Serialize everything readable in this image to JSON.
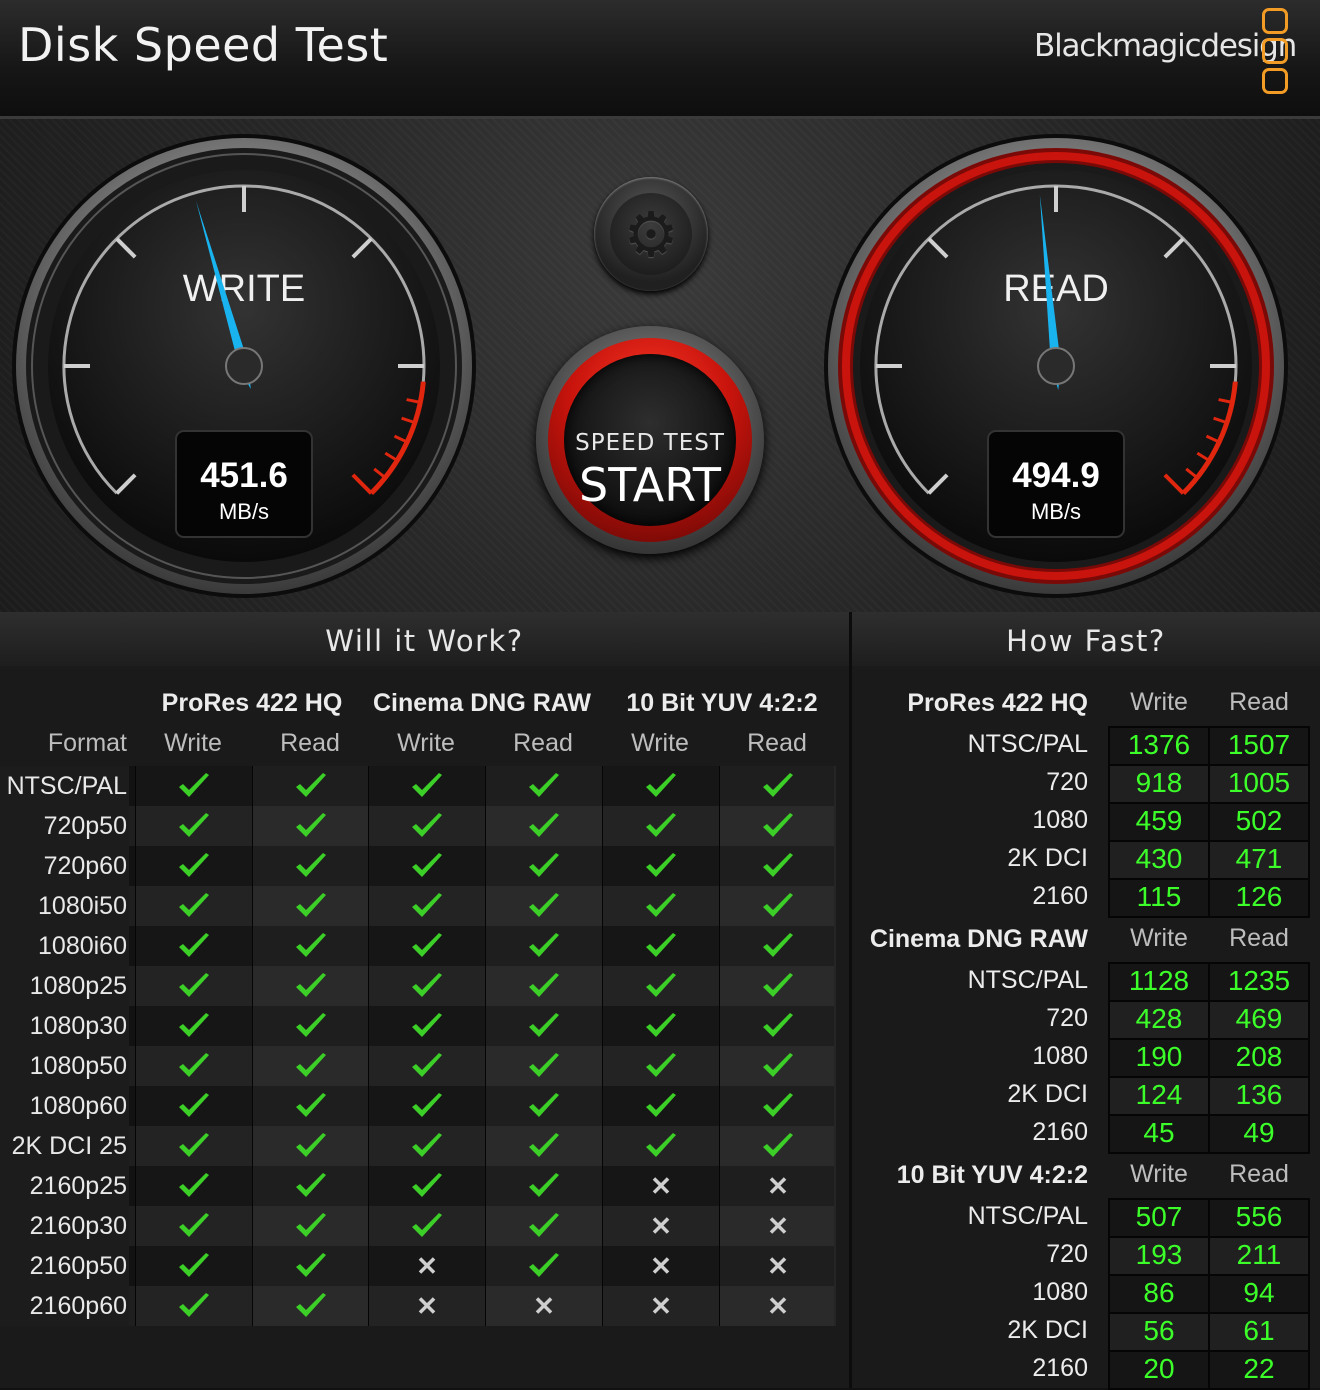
{
  "app": {
    "title": "Disk Speed Test",
    "brand": "Blackmagicdesign"
  },
  "gauges": {
    "write": {
      "label": "WRITE",
      "value": "451.6",
      "unit": "MB/s",
      "needle_fraction": 0.44
    },
    "read": {
      "label": "READ",
      "value": "494.9",
      "unit": "MB/s",
      "needle_fraction": 0.48
    }
  },
  "start_button": {
    "top": "SPEED TEST",
    "main": "START"
  },
  "sections": {
    "will_it_work": "Will it Work?",
    "how_fast": "How Fast?"
  },
  "will_it_work": {
    "format_label": "Format",
    "codecs": [
      "ProRes 422 HQ",
      "Cinema DNG RAW",
      "10 Bit YUV 4:2:2"
    ],
    "sub_labels": [
      "Write",
      "Read",
      "Write",
      "Read",
      "Write",
      "Read"
    ],
    "rows": [
      {
        "format": "NTSC/PAL",
        "results": [
          true,
          true,
          true,
          true,
          true,
          true
        ]
      },
      {
        "format": "720p50",
        "results": [
          true,
          true,
          true,
          true,
          true,
          true
        ]
      },
      {
        "format": "720p60",
        "results": [
          true,
          true,
          true,
          true,
          true,
          true
        ]
      },
      {
        "format": "1080i50",
        "results": [
          true,
          true,
          true,
          true,
          true,
          true
        ]
      },
      {
        "format": "1080i60",
        "results": [
          true,
          true,
          true,
          true,
          true,
          true
        ]
      },
      {
        "format": "1080p25",
        "results": [
          true,
          true,
          true,
          true,
          true,
          true
        ]
      },
      {
        "format": "1080p30",
        "results": [
          true,
          true,
          true,
          true,
          true,
          true
        ]
      },
      {
        "format": "1080p50",
        "results": [
          true,
          true,
          true,
          true,
          true,
          true
        ]
      },
      {
        "format": "1080p60",
        "results": [
          true,
          true,
          true,
          true,
          true,
          true
        ]
      },
      {
        "format": "2K DCI 25",
        "results": [
          true,
          true,
          true,
          true,
          true,
          true
        ]
      },
      {
        "format": "2160p25",
        "results": [
          true,
          true,
          true,
          true,
          false,
          false
        ]
      },
      {
        "format": "2160p30",
        "results": [
          true,
          true,
          true,
          true,
          false,
          false
        ]
      },
      {
        "format": "2160p50",
        "results": [
          true,
          true,
          false,
          true,
          false,
          false
        ]
      },
      {
        "format": "2160p60",
        "results": [
          true,
          true,
          false,
          false,
          false,
          false
        ]
      }
    ]
  },
  "how_fast": {
    "write_label": "Write",
    "read_label": "Read",
    "groups": [
      {
        "codec": "ProRes 422 HQ",
        "rows": [
          {
            "format": "NTSC/PAL",
            "write": "1376",
            "read": "1507"
          },
          {
            "format": "720",
            "write": "918",
            "read": "1005"
          },
          {
            "format": "1080",
            "write": "459",
            "read": "502"
          },
          {
            "format": "2K DCI",
            "write": "430",
            "read": "471"
          },
          {
            "format": "2160",
            "write": "115",
            "read": "126"
          }
        ]
      },
      {
        "codec": "Cinema DNG RAW",
        "rows": [
          {
            "format": "NTSC/PAL",
            "write": "1128",
            "read": "1235"
          },
          {
            "format": "720",
            "write": "428",
            "read": "469"
          },
          {
            "format": "1080",
            "write": "190",
            "read": "208"
          },
          {
            "format": "2K DCI",
            "write": "124",
            "read": "136"
          },
          {
            "format": "2160",
            "write": "45",
            "read": "49"
          }
        ]
      },
      {
        "codec": "10 Bit YUV 4:2:2",
        "rows": [
          {
            "format": "NTSC/PAL",
            "write": "507",
            "read": "556"
          },
          {
            "format": "720",
            "write": "193",
            "read": "211"
          },
          {
            "format": "1080",
            "write": "86",
            "read": "94"
          },
          {
            "format": "2K DCI",
            "write": "56",
            "read": "61"
          },
          {
            "format": "2160",
            "write": "20",
            "read": "22"
          }
        ]
      }
    ]
  },
  "colors": {
    "needle": "#19b4f0",
    "check": "#3ccf28",
    "value_green": "#3cff2a",
    "accent_red": "#d81a10",
    "logo_orange": "#f39c25"
  }
}
